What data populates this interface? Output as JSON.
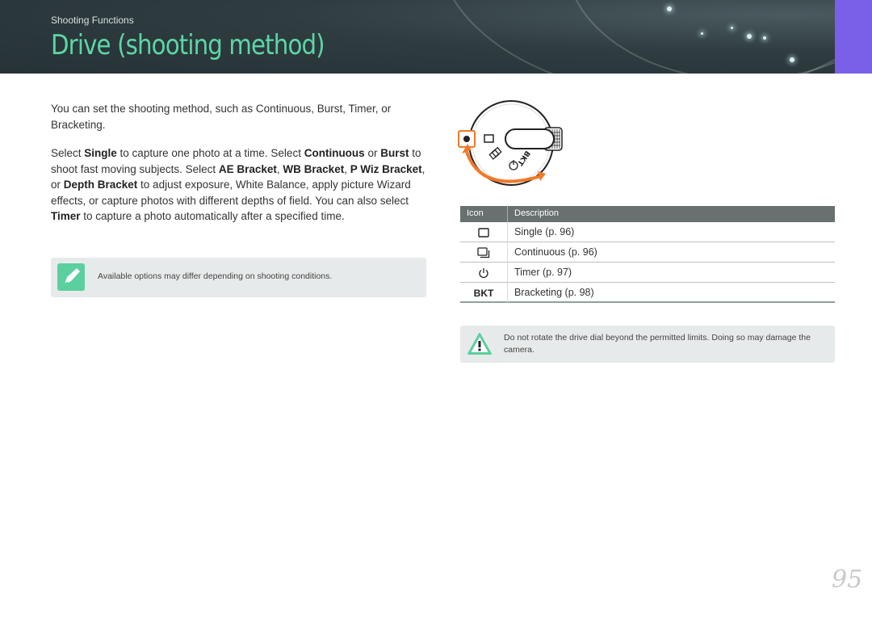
{
  "header": {
    "section": "Shooting Functions",
    "title": "Drive (shooting method)"
  },
  "intro": "You can set the shooting method, such as Continuous, Burst, Timer, or Bracketing.",
  "body": {
    "p1": "Select ",
    "single": "Single",
    "p2": " to capture one photo at a time. Select ",
    "continuous": "Continuous",
    "p3": " or ",
    "burst": "Burst",
    "p4": " to shoot fast moving subjects. Select ",
    "ae": "AE Bracket",
    "p5": ", ",
    "wb": "WB Bracket",
    "p6": ", ",
    "pwiz": "P Wiz Bracket",
    "p7": ", or ",
    "depth": "Depth Bracket",
    "p8": " to adjust exposure, White Balance, apply picture Wizard effects, or capture photos with different depths of field. You can also select ",
    "timer": "Timer",
    "p9": " to capture a photo automatically after a specified time."
  },
  "note": "Available options may differ depending on shooting conditions.",
  "dial": {
    "label": "BKT"
  },
  "table": {
    "col_icon": "Icon",
    "col_desc": "Description",
    "rows": [
      {
        "icon": "single-frame-icon",
        "desc": "Single (p. 96)"
      },
      {
        "icon": "continuous-frames-icon",
        "desc": "Continuous (p. 96)"
      },
      {
        "icon": "timer-icon",
        "desc": "Timer (p. 97)"
      },
      {
        "icon": "bkt-icon",
        "icon_text": "BKT",
        "desc": "Bracketing (p. 98)"
      }
    ]
  },
  "caution": "Do not rotate the drive dial beyond the permitted limits. Doing so may damage the camera.",
  "page_number": "95",
  "colors": {
    "accent": "#5cd6a6",
    "tab": "#7a5fe8",
    "arrow": "#f07a2a"
  }
}
